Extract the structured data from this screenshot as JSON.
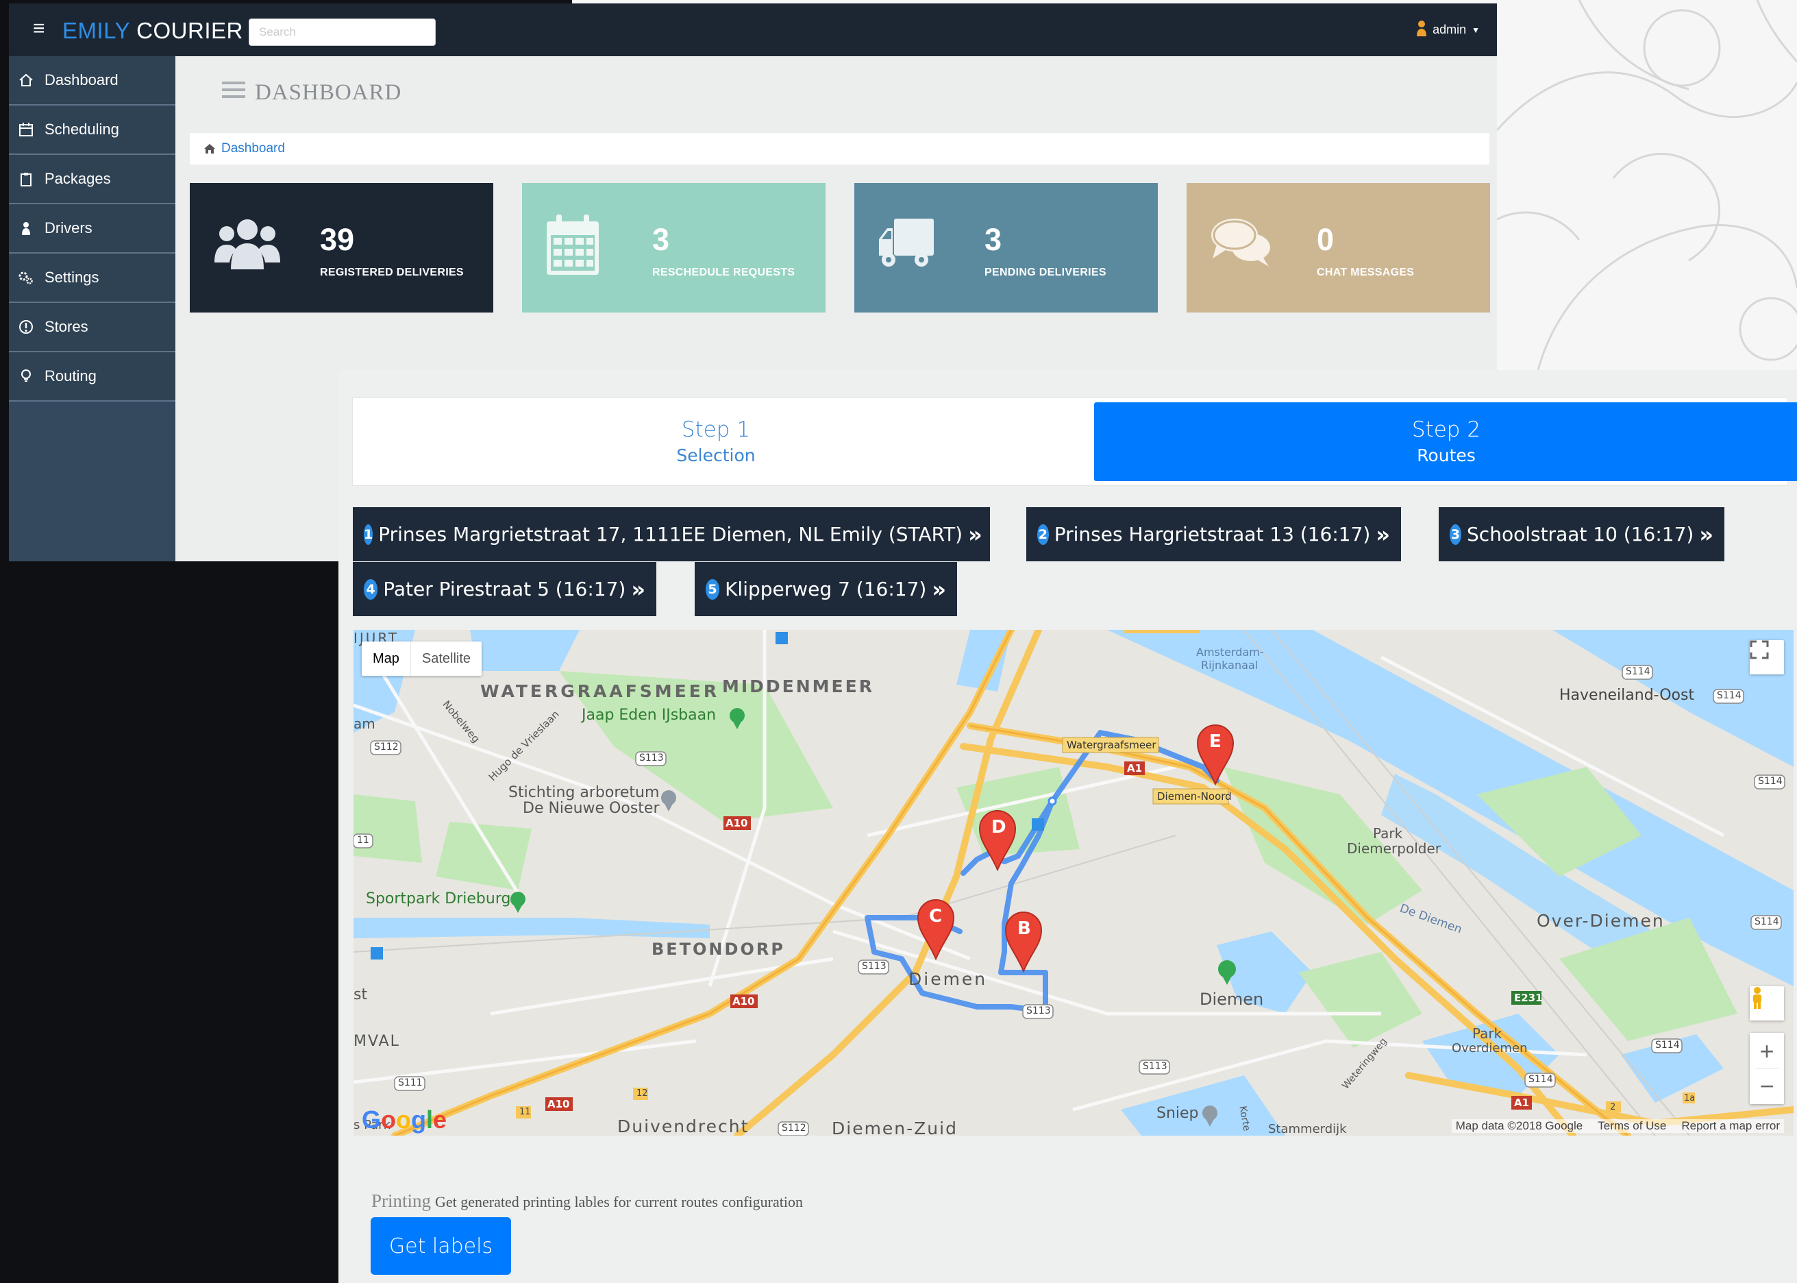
{
  "app": {
    "brand_part1": "EMILY",
    "brand_part2": " COURIER",
    "search_placeholder": "Search",
    "user_name": "admin"
  },
  "sidebar": {
    "items": [
      {
        "label": "Dashboard",
        "icon": "home-icon"
      },
      {
        "label": "Scheduling",
        "icon": "calendar-icon"
      },
      {
        "label": "Packages",
        "icon": "clipboard-icon"
      },
      {
        "label": "Drivers",
        "icon": "user-icon"
      },
      {
        "label": "Settings",
        "icon": "gears-icon"
      },
      {
        "label": "Stores",
        "icon": "exclamation-circle-icon"
      },
      {
        "label": "Routing",
        "icon": "lightbulb-icon"
      }
    ]
  },
  "page": {
    "title": "DASHBOARD",
    "breadcrumb": "Dashboard"
  },
  "stats": [
    {
      "value": "39",
      "label": "REGISTERED DELIVERIES",
      "color": "#1c2633",
      "icon": "users-icon"
    },
    {
      "value": "3",
      "label": "RESCHEDULE REQUESTS",
      "color": "#97d3c2",
      "icon": "calendar-icon"
    },
    {
      "value": "3",
      "label": "PENDING DELIVERIES",
      "color": "#5b8a9f",
      "icon": "truck-icon"
    },
    {
      "value": "0",
      "label": "CHAT MESSAGES",
      "color": "#cdb793",
      "icon": "comments-icon"
    }
  ],
  "wizard": {
    "step1_title": "Step 1",
    "step1_sub": "Selection",
    "step2_title": "Step 2",
    "step2_sub": "Routes",
    "active_color": "#007bff"
  },
  "routes": [
    {
      "num": "1",
      "label": "Prinses Margrietstraat 17, 1111EE Diemen, NL Emily (START)"
    },
    {
      "num": "2",
      "label": "Prinses Hargrietstraat 13 (16:17)"
    },
    {
      "num": "3",
      "label": "Schoolstraat 10 (16:17)"
    },
    {
      "num": "4",
      "label": "Pater Pirestraat 5 (16:17)"
    },
    {
      "num": "5",
      "label": "Klipperweg 7 (16:17)"
    }
  ],
  "map": {
    "type_map": "Map",
    "type_satellite": "Satellite",
    "attribution": "Map data ©2018 Google",
    "terms": "Terms of Use",
    "report": "Report a map error",
    "google": "Google",
    "markers": [
      "B",
      "C",
      "D",
      "E"
    ],
    "labels": {
      "watergraafsmeer": "WATERGRAAFSMEER",
      "middenmeer": "MIDDENMEER",
      "jaap_eden": "Jaap Eden IJsbaan",
      "stichting1": "Stichting arboretum",
      "stichting2": "De Nieuwe Ooster",
      "sportpark": "Sportpark Drieburg",
      "betondorp": "BETONDORP",
      "diemen_centre": "Diemen",
      "diemen_east": "Diemen",
      "duivendrecht": "Duivendrecht",
      "diemen_zuid": "Diemen-Zuid",
      "sniep": "Sniep",
      "park_diemerpolder1": "Park",
      "park_diemerpolder2": "Diemerpolder",
      "over_diemen": "Over-Diemen",
      "park_overdiemen1": "Park",
      "park_overdiemen2": "Overdiemen",
      "haveneiland": "Haveneiland-Oost",
      "amsterdam_rijnkanaal1": "Amsterdam-",
      "amsterdam_rijnkanaal2": "Rijnkanaal",
      "watergraafsmeer_sign": "Watergraafsmeer",
      "diemen_noord": "Diemen-Noord",
      "de_diemen": "De Diemen",
      "nobelweg": "Nobelweg",
      "hugo": "Hugo de Vrieslaan",
      "weteringweg": "Weteringweg",
      "ijburg_left": "IJURT",
      "am": "am",
      "st": "st",
      "mval": "MVAL",
      "s_park": "s Park",
      "korte": "Korte",
      "stammerdijk": "Stammerdijk",
      "a10": "A10",
      "a1": "A1",
      "e231": "E231",
      "s112": "S112",
      "s113": "S113",
      "s114": "S114",
      "s111": "S111",
      "s11": "11",
      "n12": "12",
      "n11": "11",
      "n1a": "1a",
      "n2": "2"
    }
  },
  "printing": {
    "title": "Printing",
    "description": "Get generated printing lables for current routes configuration",
    "button": "Get labels"
  }
}
